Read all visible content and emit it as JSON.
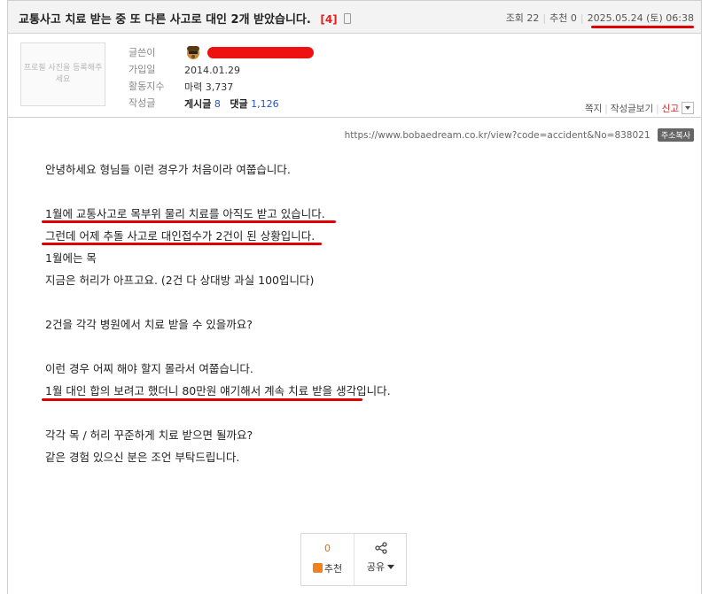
{
  "post": {
    "title": "교통사고 치료 받는 중 또 다른 사고로 대인 2개 받았습니다.",
    "comment_count": "[4]",
    "views_label": "조회 22",
    "recommend_label": "추천 0",
    "datetime": "2025.05.24 (토) 06:38"
  },
  "author": {
    "profile_placeholder": "프로필 사진을 등록해주세요",
    "labels": {
      "writer": "글쓴이",
      "joined": "가입일",
      "activity": "활동지수",
      "posts": "작성글"
    },
    "joined": "2014.01.29",
    "activity_value": "마력 3,737",
    "posts_label": "게시글",
    "posts_count": "8",
    "comments_label": "댓글",
    "comments_count": "1,126",
    "actions": {
      "message": "쪽지",
      "view_posts": "작성글보기",
      "report": "신고"
    }
  },
  "url_bar": {
    "url": "https://www.bobaedream.co.kr/view?code=accident&No=838021",
    "copy_label": "주소복사"
  },
  "body_lines": [
    "안녕하세요 형님들 이런 경우가 처음이라 여쭙습니다.",
    "",
    "1월에 교통사고로 목부위 물리 치료를 아직도 받고 있습니다.",
    "그런데 어제 추돌 사고로 대인접수가 2건이 된 상황입니다.",
    "1월에는 목",
    "지금은 허리가 아프고요. (2건 다 상대방 과실 100입니다)",
    "",
    "2건을 각각 병원에서 치료 받을 수 있을까요?",
    "",
    "이런 경우 어찌 해야 할지 몰라서 여쭙습니다.",
    "1월 대인 합의 보려고 했더니 80만원 얘기해서 계속 치료 받을 생각입니다.",
    "",
    "각각 목 / 허리 꾸준하게 치료 받으면 될까요?",
    "같은 경험 있으신 분은 조언 부탁드립니다."
  ],
  "vote": {
    "count": "0",
    "recommend_label": "추천",
    "share_label": "공유"
  },
  "colors": {
    "highlight_red": "#e00000",
    "count_red": "#e02020",
    "link_blue": "#2255cc",
    "thumb_orange": "#f08020"
  }
}
